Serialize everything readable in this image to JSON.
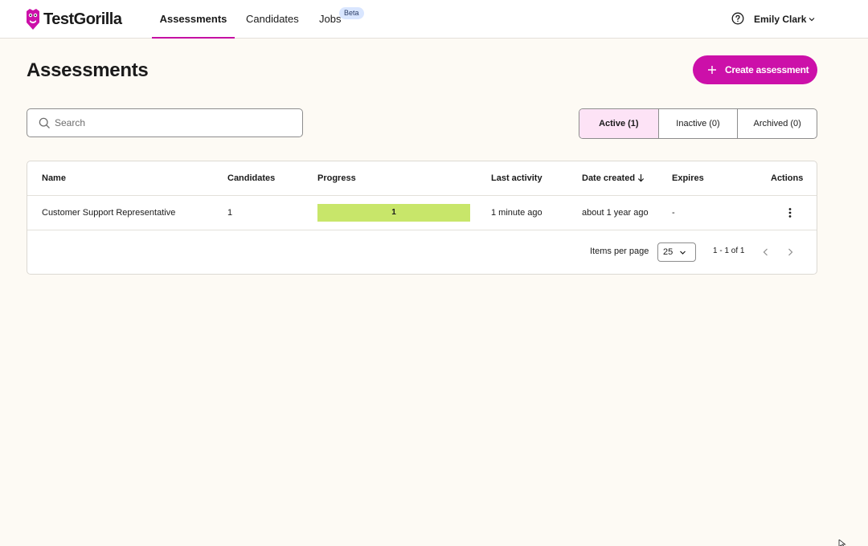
{
  "brand": {
    "name": "TestGorilla",
    "accent": "#cc10a9",
    "logo_icon": "gorilla-logo-icon"
  },
  "nav": {
    "items": [
      {
        "label": "Assessments",
        "active": true
      },
      {
        "label": "Candidates",
        "active": false
      },
      {
        "label": "Jobs",
        "active": false,
        "badge": "Beta"
      }
    ]
  },
  "user": {
    "name": "Emily Clark",
    "help_icon": "help-circle-icon",
    "menu_icon": "chevron-down-icon"
  },
  "header": {
    "title": "Assessments",
    "create_label": "Create assessment"
  },
  "search": {
    "placeholder": "Search",
    "value": ""
  },
  "filters": [
    {
      "label": "Active (1)",
      "active": true
    },
    {
      "label": "Inactive (0)",
      "active": false
    },
    {
      "label": "Archived (0)",
      "active": false
    }
  ],
  "table": {
    "columns": [
      "Name",
      "Candidates",
      "Progress",
      "Last activity",
      "Date created",
      "Expires",
      "Actions"
    ],
    "sort_column": "Date created",
    "rows": [
      {
        "name": "Customer Support Representative",
        "candidates": "1",
        "progress_label": "1",
        "progress_fraction": 1.0,
        "last_activity": "1 minute ago",
        "date_created": "about 1 year ago",
        "expires": "-"
      }
    ]
  },
  "pagination": {
    "items_per_page_label": "Items per page",
    "items_per_page": "25",
    "range": "1 - 1 of 1"
  },
  "colors": {
    "progress": "#c8e66a",
    "active_filter_bg": "#fde3f6",
    "page_bg": "#fdfaf4"
  }
}
